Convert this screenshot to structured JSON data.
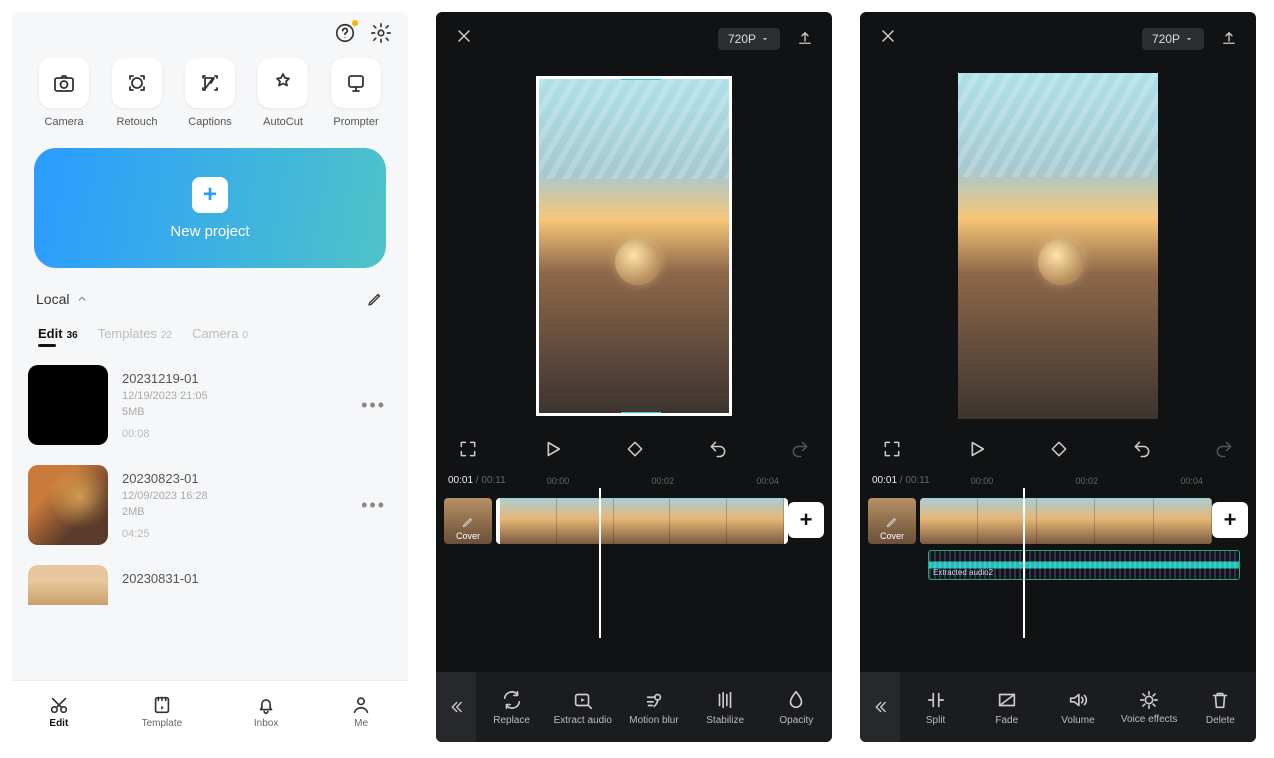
{
  "screen1": {
    "tools": [
      {
        "label": "Camera",
        "icon": "camera"
      },
      {
        "label": "Retouch",
        "icon": "retouch"
      },
      {
        "label": "Captions",
        "icon": "captions"
      },
      {
        "label": "AutoCut",
        "icon": "autocut"
      },
      {
        "label": "Prompter",
        "icon": "prompter"
      }
    ],
    "newProject": "New project",
    "localLabel": "Local",
    "tabs": [
      {
        "label": "Edit",
        "count": "36",
        "active": true
      },
      {
        "label": "Templates",
        "count": "22",
        "active": false
      },
      {
        "label": "Camera",
        "count": "0",
        "active": false
      }
    ],
    "projects": [
      {
        "name": "20231219-01",
        "date": "12/19/2023 21:05",
        "size": "5MB",
        "duration": "00:08"
      },
      {
        "name": "20230823-01",
        "date": "12/09/2023 16:28",
        "size": "2MB",
        "duration": "04:25"
      },
      {
        "name": "20230831-01",
        "date": "",
        "size": "",
        "duration": ""
      }
    ],
    "bottomNav": [
      {
        "label": "Edit",
        "active": true
      },
      {
        "label": "Template",
        "active": false
      },
      {
        "label": "Inbox",
        "active": false
      },
      {
        "label": "Me",
        "active": false
      }
    ]
  },
  "editor": {
    "resolution": "720P",
    "currentTime": "00:01",
    "totalTime": "00:11",
    "timeMarks": [
      "00:00",
      "00:02",
      "00:04"
    ],
    "coverLabel": "Cover",
    "audioLabel": "Extracted audio2",
    "toolbarsA": [
      {
        "label": "Replace"
      },
      {
        "label": "Extract audio"
      },
      {
        "label": "Motion blur"
      },
      {
        "label": "Stabilize"
      },
      {
        "label": "Opacity"
      }
    ],
    "toolbarsB": [
      {
        "label": "Split"
      },
      {
        "label": "Fade"
      },
      {
        "label": "Volume"
      },
      {
        "label": "Voice effects"
      },
      {
        "label": "Delete"
      }
    ]
  }
}
